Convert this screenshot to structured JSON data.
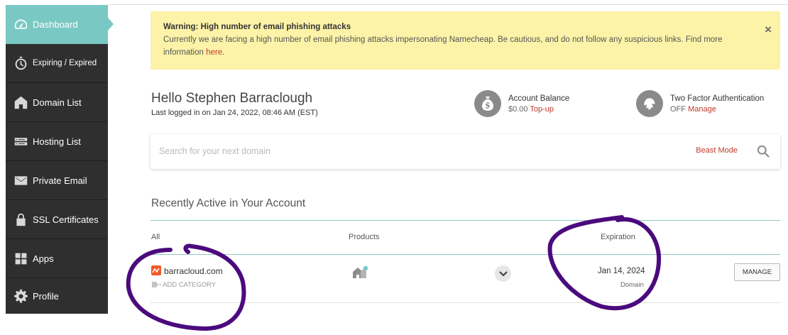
{
  "sidebar": {
    "items": [
      {
        "label": "Dashboard",
        "icon": "dashboard-gauge-icon",
        "active": true
      },
      {
        "label": "Expiring / Expired",
        "icon": "stopwatch-icon"
      },
      {
        "label": "Domain List",
        "icon": "home-icon"
      },
      {
        "label": "Hosting List",
        "icon": "server-icon"
      },
      {
        "label": "Private Email",
        "icon": "envelope-icon"
      },
      {
        "label": "SSL Certificates",
        "icon": "lock-icon"
      },
      {
        "label": "Apps",
        "icon": "apps-grid-icon"
      },
      {
        "label": "Profile",
        "icon": "gear-icon"
      }
    ],
    "active_color": "#79c8c4",
    "background": "#2f2f2f"
  },
  "warning": {
    "title": "Warning: High number of email phishing attacks",
    "text": "Currently we are facing a high number of email phishing attacks impersonating Namecheap. Be cautious, and do not follow any suspicious links. Find more information ",
    "link": "here",
    "text_end": ".",
    "close": "×",
    "background": "#fcf3a8"
  },
  "greeting": {
    "title": "Hello Stephen Barraclough",
    "last_login": "Last logged in on Jan 24, 2022, 08:46 AM (EST)"
  },
  "account_balance": {
    "title": "Account Balance",
    "value": "$0.00",
    "link": "Top-up",
    "icon": "money-bag-icon"
  },
  "two_factor": {
    "title": "Two Factor Authentication",
    "status": "OFF",
    "link": "Manage",
    "icon": "fingerprint-icon"
  },
  "search": {
    "placeholder": "Search for your next domain",
    "beast_mode": "Beast Mode"
  },
  "recent": {
    "title": "Recently Active in Your Account",
    "columns": [
      "All",
      "Products",
      "Expiration"
    ],
    "rows": [
      {
        "domain": "barracloud.com",
        "add_category": "ADD CATEGORY",
        "expiration": "Jan 14, 2024",
        "type": "Domain",
        "manage": "MANAGE"
      }
    ]
  },
  "accent_color": "#c0392b",
  "annotation_color": "#4b0a7d"
}
